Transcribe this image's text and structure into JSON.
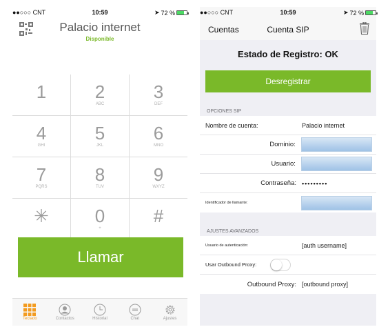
{
  "left": {
    "status": {
      "carrier": "●●○○○ CNT",
      "time": "10:59",
      "battery": "72 %"
    },
    "account_name": "Palacio internet",
    "account_status": "Disponible",
    "keys": [
      {
        "digit": "1",
        "letters": ""
      },
      {
        "digit": "2",
        "letters": "ABC"
      },
      {
        "digit": "3",
        "letters": "DEF"
      },
      {
        "digit": "4",
        "letters": "GHI"
      },
      {
        "digit": "5",
        "letters": "JKL"
      },
      {
        "digit": "6",
        "letters": "MNO"
      },
      {
        "digit": "7",
        "letters": "PQRS"
      },
      {
        "digit": "8",
        "letters": "TUV"
      },
      {
        "digit": "9",
        "letters": "WXYZ"
      },
      {
        "digit": "✳",
        "letters": ""
      },
      {
        "digit": "0",
        "letters": "+"
      },
      {
        "digit": "#",
        "letters": ""
      }
    ],
    "call_label": "Llamar",
    "tabs": [
      {
        "label": "Teclado",
        "icon": "keypad-grid-icon"
      },
      {
        "label": "Contactos",
        "icon": "contact-icon"
      },
      {
        "label": "Historial",
        "icon": "clock-icon"
      },
      {
        "label": "Chat",
        "icon": "chat-icon"
      },
      {
        "label": "Ajustes",
        "icon": "gear-icon"
      }
    ]
  },
  "right": {
    "status": {
      "carrier": "●●○○○ CNT",
      "time": "10:59",
      "battery": "72 %"
    },
    "back_label": "Cuentas",
    "title": "Cuenta SIP",
    "registration_status": "Estado de Registro: OK",
    "deregister_label": "Desregistrar",
    "sip_section": "OPCIONES SIP",
    "account_name_label": "Nombre de cuenta:",
    "account_name_value": "Palacio internet",
    "domain_label": "Dominio:",
    "user_label": "Usuario:",
    "password_label": "Contraseña:",
    "password_value": "•••••••••",
    "caller_id_label": "Identificador de llamante:",
    "advanced_section": "AJUSTES AVANZADOS",
    "auth_user_label": "Usuario de autenticación:",
    "auth_user_placeholder": "[auth username]",
    "outbound_use_label": "Usar Outbound Proxy:",
    "outbound_proxy_label": "Outbound Proxy:",
    "outbound_proxy_placeholder": "[outbound proxy]"
  },
  "colors": {
    "accent_green": "#7ab929",
    "tab_active": "#f39b1f",
    "field_blue": "#9fc2e6"
  }
}
